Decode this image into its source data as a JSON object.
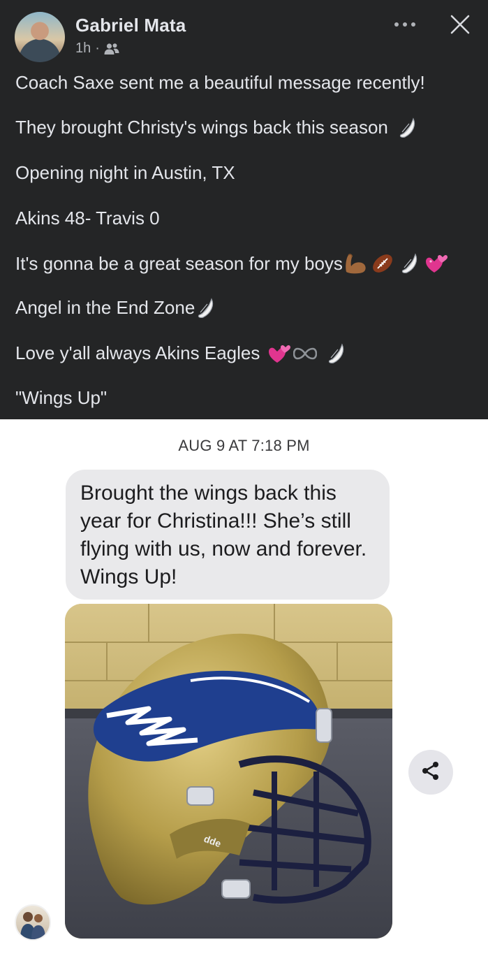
{
  "post": {
    "author": "Gabriel Mata",
    "time": "1h",
    "separator": "·",
    "audience_icon": "friends-icon",
    "lines": [
      "Coach Saxe sent me a beautiful message recently!",
      "They brought Christy's wings back this season",
      "Opening night in Austin, TX",
      "Akins 48- Travis 0",
      "It's gonna be a great season for my boys",
      "Angel in the End Zone",
      "Love y'all always Akins Eagles",
      "\"Wings Up\""
    ],
    "emoji": {
      "line2": [
        "wing"
      ],
      "line5": [
        "flexed-biceps",
        "american-football",
        "wing",
        "two-hearts"
      ],
      "line6": [
        "wing"
      ],
      "line7": [
        "two-hearts",
        "infinity",
        "wing"
      ]
    }
  },
  "message": {
    "timestamp": "AUG 9 AT 7:18 PM",
    "bubble_text": "Brought the wings back this year for Christina!!! She’s still flying with us, now and forever. Wings Up!",
    "photo_label": "dde"
  },
  "colors": {
    "post_background": "#242526",
    "post_text": "#e4e6eb",
    "bubble": "#e9e9eb",
    "helmet_gold": "#b8a24f",
    "wing_blue": "#1f3f8f"
  }
}
